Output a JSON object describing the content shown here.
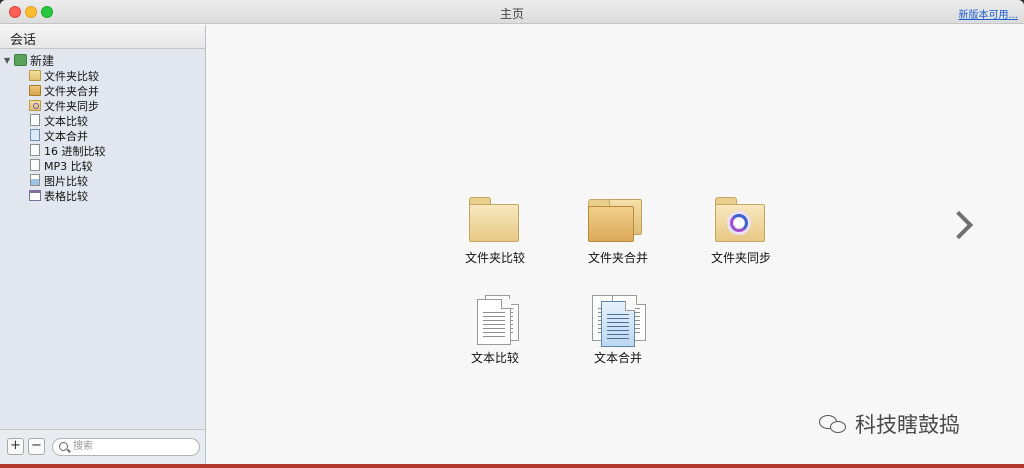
{
  "window": {
    "title": "主页",
    "update_link": "新版本可用..."
  },
  "sidebar": {
    "header": "会话",
    "root": {
      "label": "新建",
      "icon": "new-session-icon"
    },
    "items": [
      {
        "label": "文件夹比较",
        "icon": "folder-icon"
      },
      {
        "label": "文件夹合并",
        "icon": "folder-merge-icon"
      },
      {
        "label": "文件夹同步",
        "icon": "folder-sync-icon"
      },
      {
        "label": "文本比较",
        "icon": "document-icon"
      },
      {
        "label": "文本合并",
        "icon": "document-merge-icon"
      },
      {
        "label": "16 进制比较",
        "icon": "hex-file-icon"
      },
      {
        "label": "MP3 比较",
        "icon": "mp3-file-icon"
      },
      {
        "label": "图片比较",
        "icon": "picture-file-icon"
      },
      {
        "label": "表格比较",
        "icon": "table-icon"
      }
    ],
    "footer": {
      "add_label": "+",
      "remove_label": "−",
      "search_placeholder": "搜索"
    }
  },
  "main": {
    "tiles": [
      {
        "label": "文件夹比较",
        "icon": "folder-compare-icon"
      },
      {
        "label": "文件夹合并",
        "icon": "folder-merge-icon"
      },
      {
        "label": "文件夹同步",
        "icon": "folder-sync-icon"
      },
      {
        "label": "文本比较",
        "icon": "text-compare-icon"
      },
      {
        "label": "文本合并",
        "icon": "text-merge-icon"
      }
    ],
    "next_icon": "chevron-right-icon"
  },
  "watermark": {
    "text": "科技瞎鼓捣",
    "icon": "wechat-icon"
  },
  "colors": {
    "close": "#fe5f57",
    "minimize": "#febc2e",
    "maximize": "#28c840",
    "sidebar_bg": "#e2e7ef",
    "link": "#1a5fd6"
  }
}
